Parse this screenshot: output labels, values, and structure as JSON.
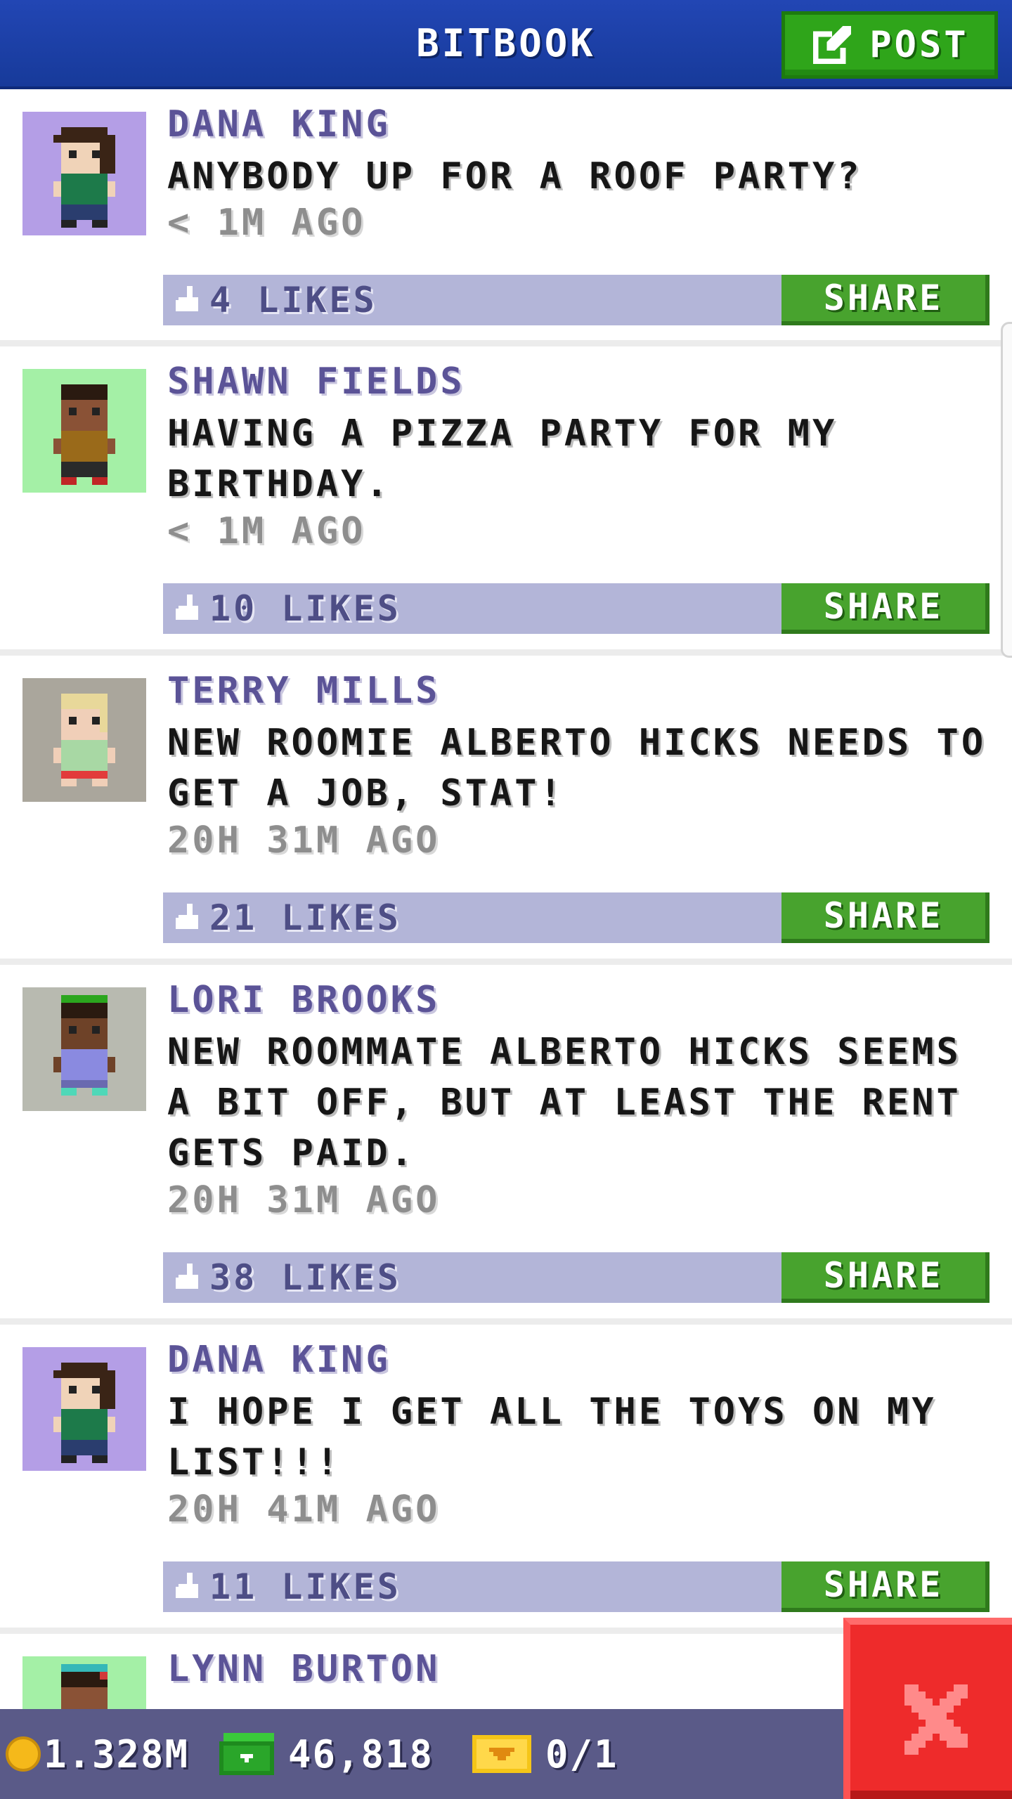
{
  "header": {
    "title": "BITBOOK",
    "post_label": "POST"
  },
  "posts": [
    {
      "author": "DANA KING",
      "lines": [
        "ANYBODY UP FOR A ROOF PARTY?"
      ],
      "time": "< 1M AGO",
      "likes": "4 LIKES",
      "share_label": "SHARE",
      "avatar_bg": "#b49ee6"
    },
    {
      "author": "SHAWN FIELDS",
      "lines": [
        "HAVING A PIZZA PARTY FOR MY",
        "BIRTHDAY."
      ],
      "time": "< 1M AGO",
      "likes": "10 LIKES",
      "share_label": "SHARE",
      "avatar_bg": "#a4f0a6"
    },
    {
      "author": "TERRY MILLS",
      "lines": [
        "NEW ROOMIE ALBERTO HICKS NEEDS TO",
        "GET A JOB, STAT!"
      ],
      "time": "20H 31M AGO",
      "likes": "21 LIKES",
      "share_label": "SHARE",
      "avatar_bg": "#aaa69c"
    },
    {
      "author": "LORI BROOKS",
      "lines": [
        "NEW ROOMMATE ALBERTO HICKS SEEMS",
        "A BIT OFF, BUT AT LEAST THE RENT",
        "GETS PAID."
      ],
      "time": "20H 31M AGO",
      "likes": "38 LIKES",
      "share_label": "SHARE",
      "avatar_bg": "#b8bab0"
    },
    {
      "author": "DANA KING",
      "lines": [
        "I HOPE I GET ALL THE TOYS ON MY",
        "LIST!!!"
      ],
      "time": "20H 41M AGO",
      "likes": "11 LIKES",
      "share_label": "SHARE",
      "avatar_bg": "#b49ee6"
    },
    {
      "author": "LYNN BURTON",
      "avatar_bg": "#a4f0a6"
    }
  ],
  "status_bar": {
    "coins": "1.328M",
    "bux": "46,818",
    "tickets": "0/1"
  },
  "colors": {
    "header_blue": "#1f44ad",
    "share_green": "#48a32e",
    "like_bar": "#b3b5d8",
    "close_red": "#ee2b2b"
  },
  "icons": {
    "post": "edit-icon",
    "like": "thumbs-up-icon",
    "coin": "coin-icon",
    "bux": "bux-icon",
    "ticket": "ticket-icon",
    "close": "close-icon"
  }
}
